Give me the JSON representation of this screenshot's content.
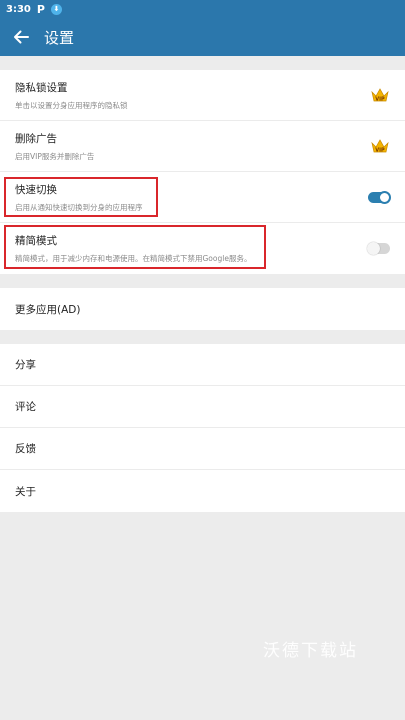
{
  "status_bar": {
    "time": "3:30",
    "parking_icon": "P"
  },
  "toolbar": {
    "title": "设置"
  },
  "settings": [
    {
      "title": "隐私锁设置",
      "subtitle": "单击以设置分身应用程序的隐私锁",
      "accessory": "vip-crown"
    },
    {
      "title": "删除广告",
      "subtitle": "启用VIP服务并删除广告",
      "accessory": "vip-crown"
    },
    {
      "title": "快速切换",
      "subtitle": "启用从通知快速切换到分身的应用程序",
      "accessory": "switch",
      "enabled": true
    },
    {
      "title": "精简模式",
      "subtitle": "精简模式，用于减少内存和电源使用。在精简模式下禁用Google服务。",
      "accessory": "switch",
      "enabled": false
    }
  ],
  "more_apps": {
    "label": "更多应用(AD)"
  },
  "misc": [
    {
      "label": "分享"
    },
    {
      "label": "评论"
    },
    {
      "label": "反馈"
    },
    {
      "label": "关于"
    }
  ],
  "vip_badge": "VIP",
  "watermark": "沃德下载站",
  "colors": {
    "accent": "#2b77ac",
    "highlight": "#d9262b",
    "background": "#ececec"
  }
}
